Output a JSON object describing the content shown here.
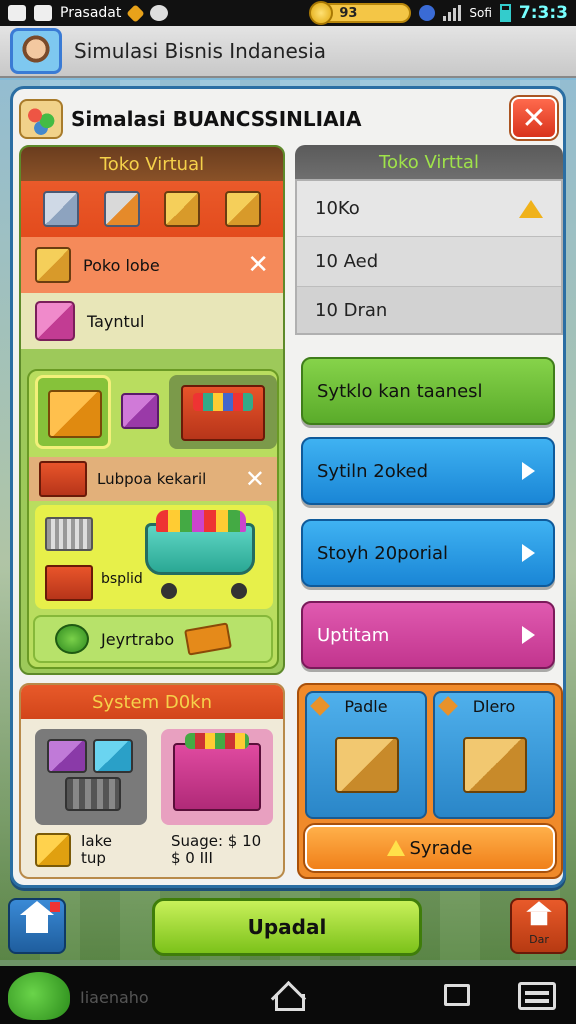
{
  "status_bar": {
    "app_name": "Prasadat",
    "coins": "93",
    "carrier": "Sofi",
    "time": "7:3:3"
  },
  "app_header": {
    "title": "Simulasi Bisnis Indanesia",
    "avatar_icon": "user-avatar-icon"
  },
  "panel": {
    "title": "Simalasi BUANCSSINLIAIA",
    "close_icon": "close-icon"
  },
  "left_column": {
    "header": "Toko Virtual",
    "row1_label": "Poko lobe",
    "row2_label": "Tayntul",
    "row3_label": "Lubpoa kekaril",
    "cart_label": "bsplid",
    "green_bar_label": "Jeyrtrabo"
  },
  "right_column": {
    "header": "Toko Virttal",
    "list": [
      "10Ko",
      "10 Aed",
      "10 Dran"
    ],
    "buttons": [
      "Sytklo kan taanesl",
      "Sytiln 2oked",
      "Stoyh 20porial",
      "Uptitam"
    ]
  },
  "system_panel": {
    "header": "System D0kn",
    "footer_line1": "Iake",
    "footer_line2": "tup",
    "note_line1": "Suage: $ 10",
    "note_line2": "$ 0 III"
  },
  "upgrade_panel": {
    "card1": "Padle",
    "card2": "Dlero",
    "button": "Syrade"
  },
  "bottom": {
    "update_button": "Upadal",
    "shop_label": "Dar"
  },
  "navbar": {
    "label": "Iiaenaho"
  },
  "colors": {
    "panel_border": "#2b6ea3",
    "accent_green": "#7cc21a",
    "accent_orange": "#f0801a",
    "accent_blue": "#1a86d6",
    "accent_pink": "#c2358e"
  }
}
